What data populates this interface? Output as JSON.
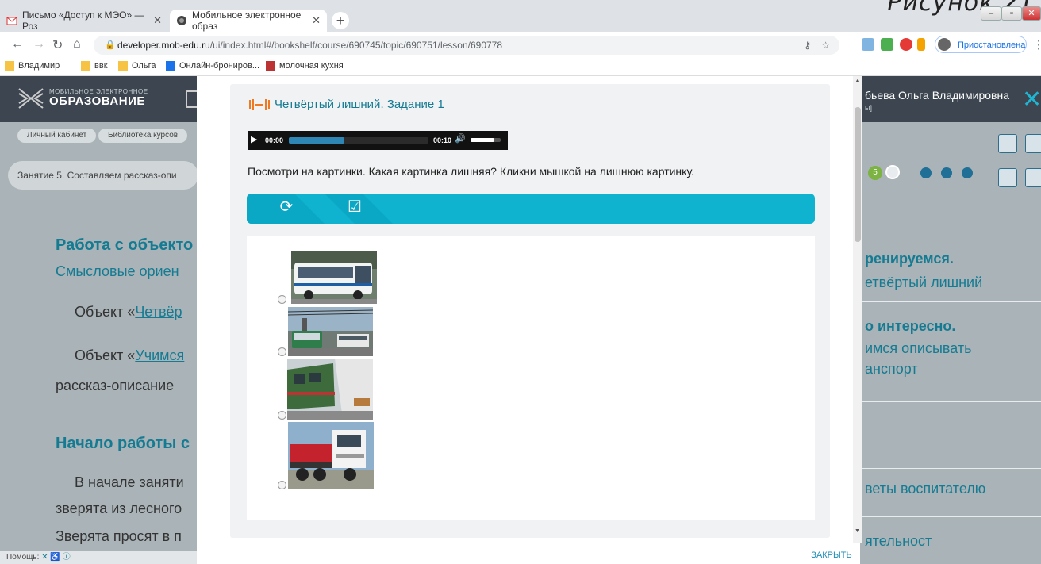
{
  "browser": {
    "tabs": [
      {
        "label": "Письмо «Доступ к МЭО» — Роз"
      },
      {
        "label": "Мобильное электронное образ"
      }
    ],
    "url_host": "developer.mob-edu.ru",
    "url_path": "/ui/index.html#/bookshelf/course/690745/topic/690751/lesson/690778",
    "profile_status": "Приостановлена",
    "bookmarks": [
      "Владимир",
      "ввк",
      "Ольга",
      "Онлайн-брониров...",
      "молочная кухня"
    ]
  },
  "figure_caption": "Рисунок 21",
  "app": {
    "logo_line1": "МОБИЛЬНОЕ ЭЛЕКТРОННОЕ",
    "logo_line2": "ОБРАЗОВАНИЕ",
    "user_name": "бьева Ольга Владимировна",
    "user_sub": "ы]",
    "breadcrumbs": [
      "Личный кабинет",
      "Библиотека курсов"
    ],
    "lesson_title": "Занятие 5. Составляем рассказ-опи",
    "progress_badge": "5",
    "help_label": "Помощь:"
  },
  "background_text": {
    "left_heading": "Работа с объекто",
    "left_sub": "Смысловые ориен",
    "p1_prefix": "Объект «",
    "p1_link": "Четвёр",
    "p2_prefix": "Объект «",
    "p2_link": "Учимся",
    "p2_cont": "рассказ-описание",
    "heading2": "Начало работы с",
    "p3": "В начале заняти",
    "p3_2": "зверята из лесного",
    "p3_3": "Зверята просят в п",
    "right_h1": "ренируемся.",
    "right_t1": "етвёртый лишний",
    "right_h2": "о интересно.",
    "right_t2a": "имся описывать",
    "right_t2b": "анспорт",
    "right_t3": "веты воспитателю",
    "right_t4": "ятельност"
  },
  "dialog": {
    "task_title": "Четвёртый лишний. Задание 1",
    "audio_current": "00:00",
    "audio_total": "00:10",
    "audio_progress": 0.4,
    "volume_level": 0.8,
    "instruction": "Посмотри на картинки. Какая картинка лишняя? Кликни мышкой на лишнюю картинку.",
    "close_label": "ЗАКРЫТЬ",
    "options": [
      "bus-image",
      "trolleybus-image",
      "train-image",
      "truck-image"
    ]
  },
  "colors": {
    "accent_teal": "#0fb3cf",
    "title_teal": "#157b92",
    "icon_orange": "#f07a22",
    "header_dark": "#3d4650"
  }
}
